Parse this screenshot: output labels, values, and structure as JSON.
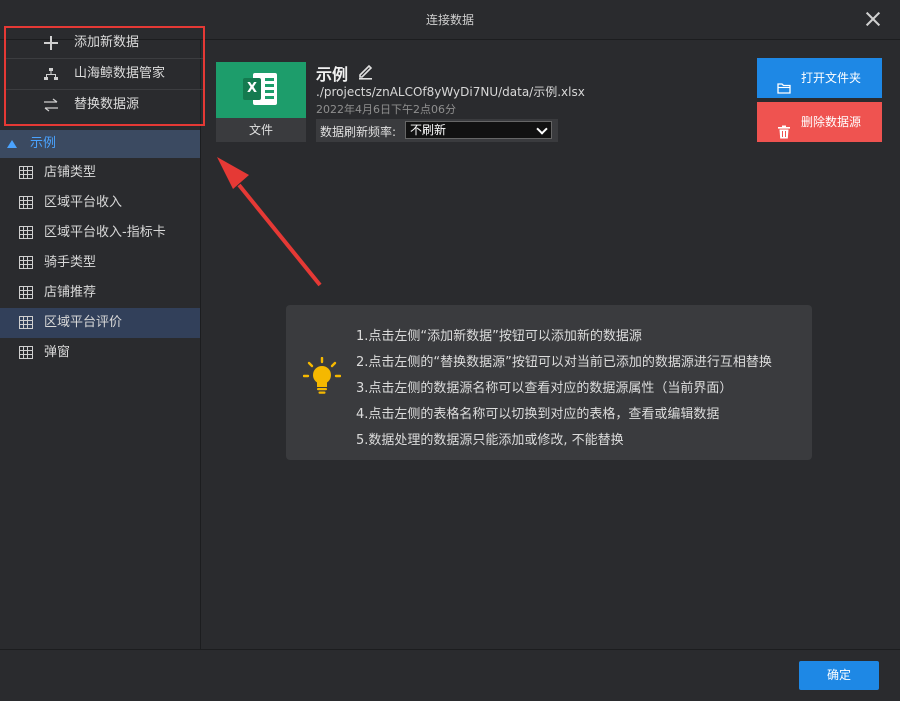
{
  "dialog": {
    "title": "连接数据"
  },
  "menu": [
    {
      "icon": "plus-icon",
      "label": "添加新数据"
    },
    {
      "icon": "org-chart-icon",
      "label": "山海鲸数据管家"
    },
    {
      "icon": "swap-icon",
      "label": "替换数据源"
    }
  ],
  "tree": {
    "source": "示例",
    "tables": [
      "店铺类型",
      "区域平台收入",
      "区域平台收入-指标卡",
      "骑手类型",
      "店铺推荐",
      "区域平台评价",
      "弹窗"
    ]
  },
  "source": {
    "file_label": "文件",
    "name": "示例",
    "path": "./projects/znALCOf8yWyDi7NU/data/示例.xlsx",
    "date": "2022年4月6日下午2点06分",
    "refresh_label": "数据刷新频率:",
    "refresh_value": "不刷新"
  },
  "buttons": {
    "open_folder": "打开文件夹",
    "delete_source": "删除数据源",
    "confirm": "确定"
  },
  "tips": [
    "1.点击左侧“添加新数据”按钮可以添加新的数据源",
    "2.点击左侧的“替换数据源”按钮可以对当前已添加的数据源进行互相替换",
    "3.点击左侧的数据源名称可以查看对应的数据源属性（当前界面）",
    "4.点击左侧的表格名称可以切换到对应的表格，查看或编辑数据",
    "5.数据处理的数据源只能添加或修改, 不能替换"
  ],
  "colors": {
    "accent": "#1e88e5",
    "danger": "#ef5350",
    "highlight": "#e53935",
    "excel": "#1d9d6b",
    "bulb": "#f5b800"
  }
}
